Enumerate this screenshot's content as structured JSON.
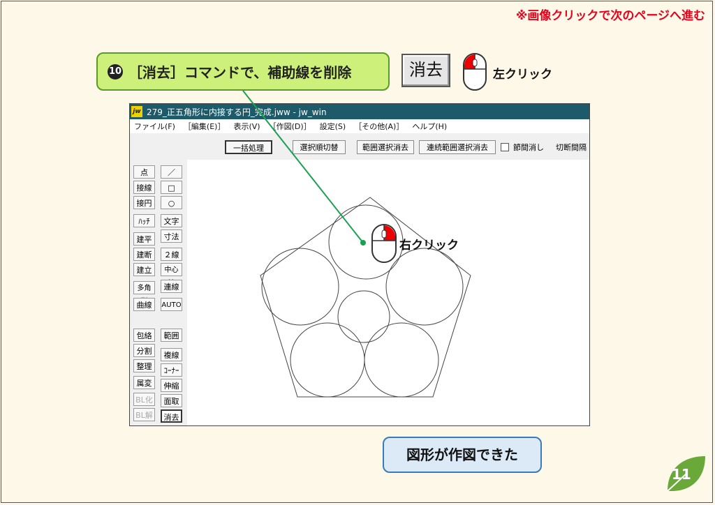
{
  "header": {
    "nav_note": "※画像クリックで次のページへ進む"
  },
  "step": {
    "number": "10",
    "instruction": "［消去］コマンドで、補助線を削除"
  },
  "erase_button_image": {
    "label": "消去"
  },
  "mouse_hints": {
    "left_click": "左クリック",
    "right_click": "右クリック"
  },
  "window": {
    "title": "279_正五角形に内接する円_完成.jww - jw_win",
    "logo": "jw",
    "menu": [
      "ファイル(F)",
      "［編集(E)］",
      "表示(V)",
      "［作図(D)］",
      "設定(S)",
      "［その他(A)］",
      "ヘルプ(H)"
    ],
    "toolbar": {
      "batch": "一括処理",
      "select_order": "選択順切替",
      "range_erase": "範囲選択消去",
      "continuous_range_erase": "連続範囲選択消去",
      "segment_erase": "節間消し",
      "cut_interval": "切断間隔"
    },
    "left_col1": [
      "点",
      "接線",
      "接円",
      "ﾊｯﾁ",
      "建平",
      "建断",
      "建立",
      "多角形",
      "曲線",
      "包絡",
      "分割",
      "整理",
      "属変",
      "BL化",
      "BL解"
    ],
    "left_col2": [
      "／",
      "□",
      "○",
      "文字",
      "寸法",
      "２線",
      "中心線",
      "連線",
      "AUTO",
      "範囲",
      "複線",
      "ｺｰﾅｰ",
      "伸縮",
      "面取",
      "消去"
    ]
  },
  "result": {
    "label": "図形が作図できた"
  },
  "page": {
    "number": "11"
  },
  "colors": {
    "background": "#fdf8e8",
    "step_fill": "#cdf07a",
    "step_border": "#5a9a28",
    "nav_note": "#e8001c",
    "result_fill": "#dbeaf6",
    "result_border": "#3a7ab8",
    "leaf": "#6aa83a",
    "titlebar": "#1e5b6a",
    "leader_line": "#1aa050"
  }
}
